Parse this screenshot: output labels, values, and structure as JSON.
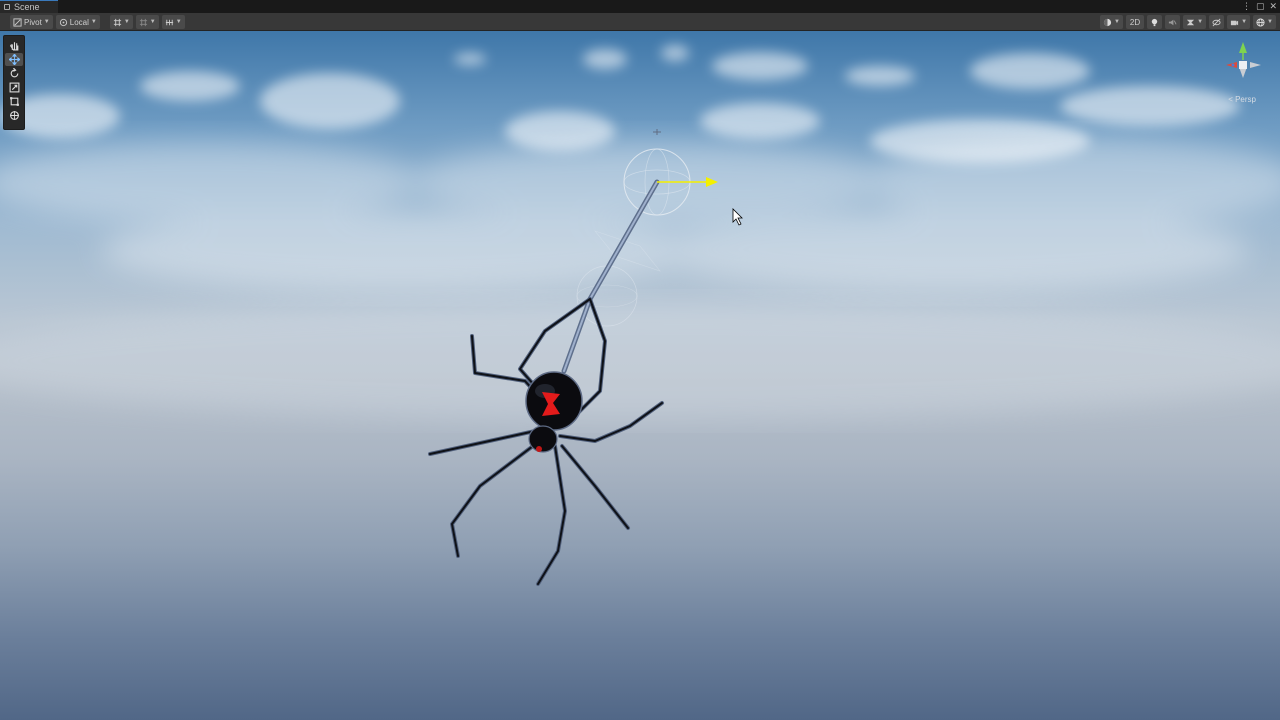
{
  "window": {
    "tab_title": "Scene"
  },
  "toolbar": {
    "pivot_label": "Pivot",
    "local_label": "Local",
    "mode_2d": "2D"
  },
  "tools": [
    "hand-tool",
    "move-tool",
    "rotate-tool",
    "scale-tool",
    "rect-tool",
    "transform-tool"
  ],
  "gizmo": {
    "persp_label": "< Persp"
  },
  "colors": {
    "accent": "#3a79bb",
    "toolbar_bg": "#383838",
    "spider_body": "#0b0b0f",
    "spider_mark": "#e31b1b",
    "handle_arrow": "#f4f000"
  }
}
